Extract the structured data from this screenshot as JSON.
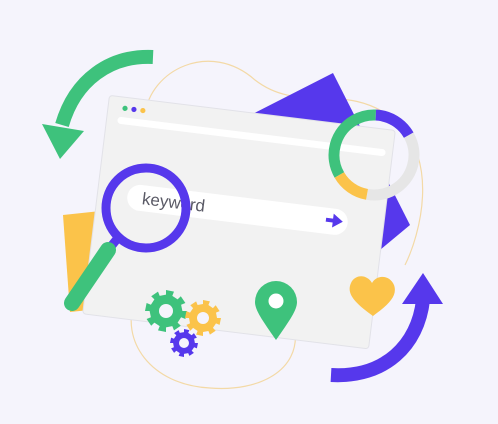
{
  "search": {
    "keyword": "keyword"
  },
  "icons": {
    "refresh_top": "curved-arrow-icon",
    "refresh_bottom": "curved-arrow-icon",
    "magnifier": "magnifying-glass-icon",
    "submit": "arrow-right-icon",
    "location": "map-pin-icon",
    "favorite": "heart-icon",
    "settings": "gears-icon",
    "analytics": "donut-chart-icon"
  },
  "colors": {
    "background": "#f5f4fc",
    "primary": "#5638ec",
    "green": "#3ec27c",
    "yellow": "#fbc34a",
    "window": "#f2f2f2",
    "donut_track": "#e6e6e6"
  },
  "donut": {
    "segments": [
      {
        "color": "#3ec27c",
        "value": 0.34
      },
      {
        "color": "#5638ec",
        "value": 0.16
      },
      {
        "color": "#e6e6e6",
        "value": 0.36
      },
      {
        "color": "#fbc34a",
        "value": 0.14
      }
    ]
  }
}
